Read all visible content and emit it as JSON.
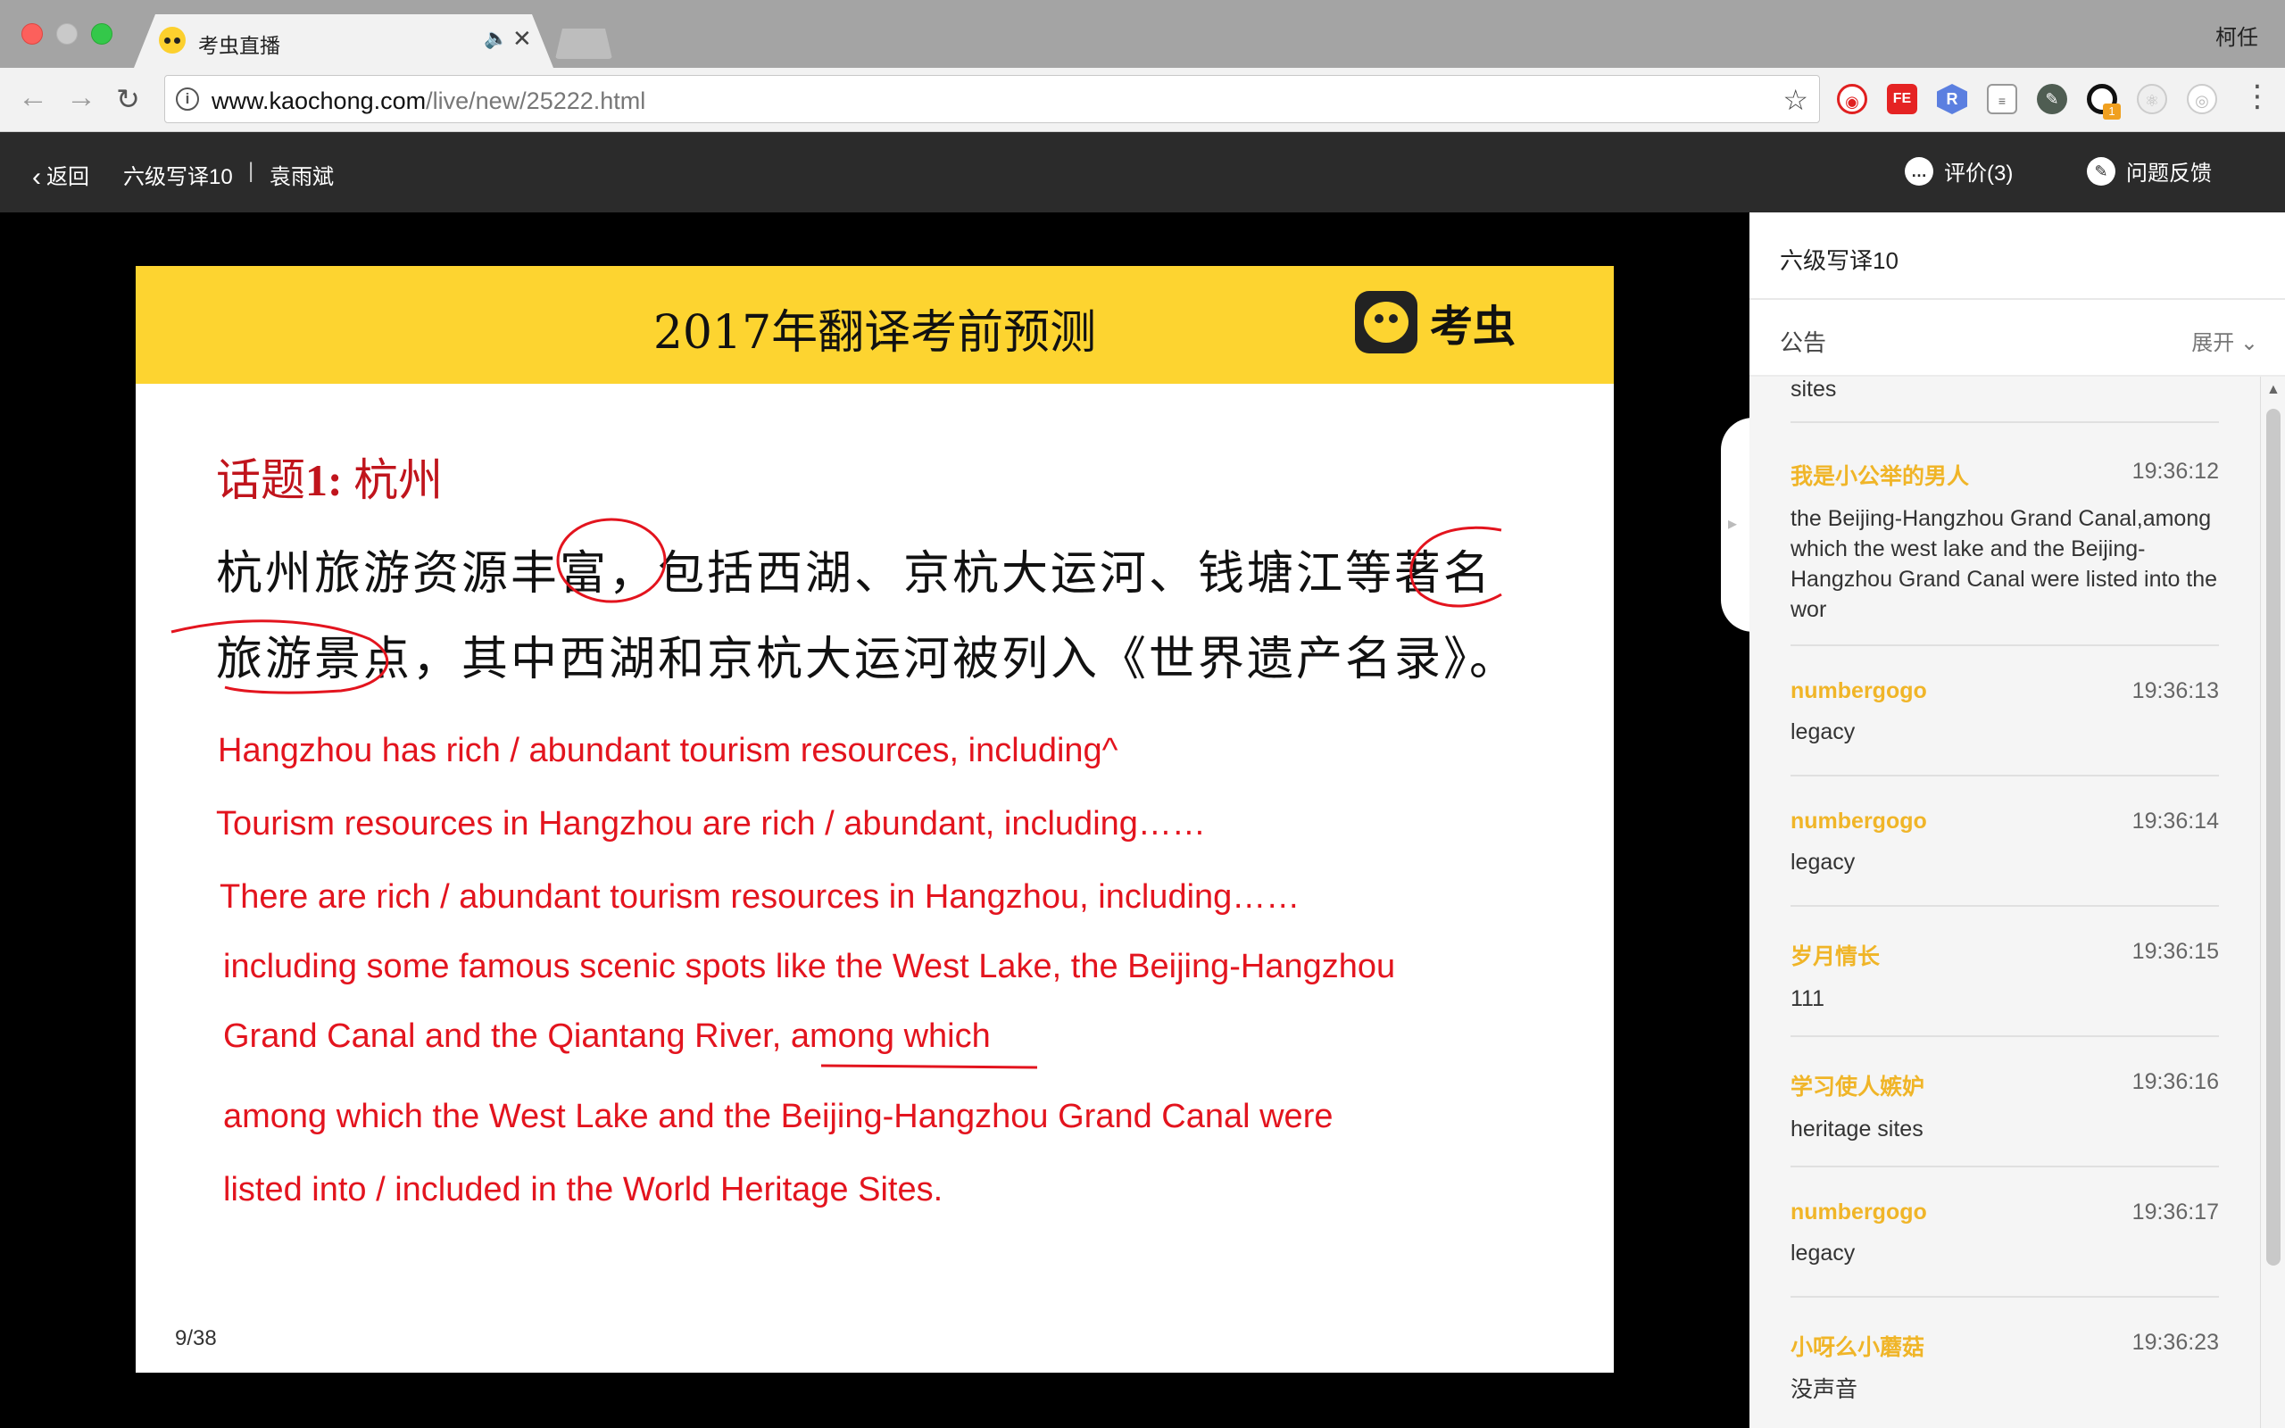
{
  "browser": {
    "tab_title": "考虫直播",
    "tab_audio": "🔈",
    "tab_close": "✕",
    "profile_name": "柯任",
    "url_host": "www.kaochong.com",
    "url_path": "/live/new/25222.html",
    "ext_badge": "1"
  },
  "header": {
    "back_label": "返回",
    "course_name": "六级写译10",
    "separator": "|",
    "teacher": "袁雨斌",
    "rating_label": "评价(3)",
    "feedback_label": "问题反馈"
  },
  "slide": {
    "title": "2017年翻译考前预测",
    "brand": "考虫",
    "topic_prefix": "话题",
    "topic_number": "1:",
    "topic_name": " 杭州",
    "zh_line_1": "杭州旅游资源丰富，包括西湖、京杭大运河、钱塘江等著名",
    "zh_line_2": "旅游景点，其中西湖和京杭大运河被列入《世界遗产名录》。",
    "en_lines": [
      "Hangzhou has rich / abundant tourism resources, including^",
      "Tourism resources in Hangzhou are rich / abundant, including……",
      "There are rich / abundant tourism resources in Hangzhou, including……",
      "including some famous scenic spots like the West Lake, the Beijing-Hangzhou",
      "Grand Canal and the Qiantang River, among which",
      "among which the West Lake and the Beijing-Hangzhou Grand Canal were",
      "listed into / included in the World Heritage Sites."
    ],
    "page_number": "9/38"
  },
  "sidebar": {
    "title": "六级写译10",
    "notice_label": "公告",
    "expand_label": "展开",
    "partial_text": "sites",
    "messages": [
      {
        "user": "我是小公举的男人",
        "time": "19:36:12",
        "text": "the Beijing-Hangzhou Grand Canal,among which the west lake and the Beijing-Hangzhou Grand Canal were listed into the wor"
      },
      {
        "user": "numbergogo",
        "time": "19:36:13",
        "text": "legacy"
      },
      {
        "user": "numbergogo",
        "time": "19:36:14",
        "text": "legacy"
      },
      {
        "user": "岁月情长",
        "time": "19:36:15",
        "text": "111"
      },
      {
        "user": "学习使人嫉妒",
        "time": "19:36:16",
        "text": "heritage sites"
      },
      {
        "user": "numbergogo",
        "time": "19:36:17",
        "text": "legacy"
      },
      {
        "user": "小呀么小蘑菇",
        "time": "19:36:23",
        "text": "没声音"
      }
    ]
  },
  "colors": {
    "accent_yellow": "#fdd430",
    "annotation_red": "#e3141e",
    "username_gold": "#f0b528",
    "header_dark": "#2b2b2b"
  },
  "icons": {
    "back": "chevron-left-icon",
    "rating": "comment-icon",
    "feedback": "pencil-icon",
    "star": "star-icon",
    "menu": "kebab-menu-icon"
  }
}
